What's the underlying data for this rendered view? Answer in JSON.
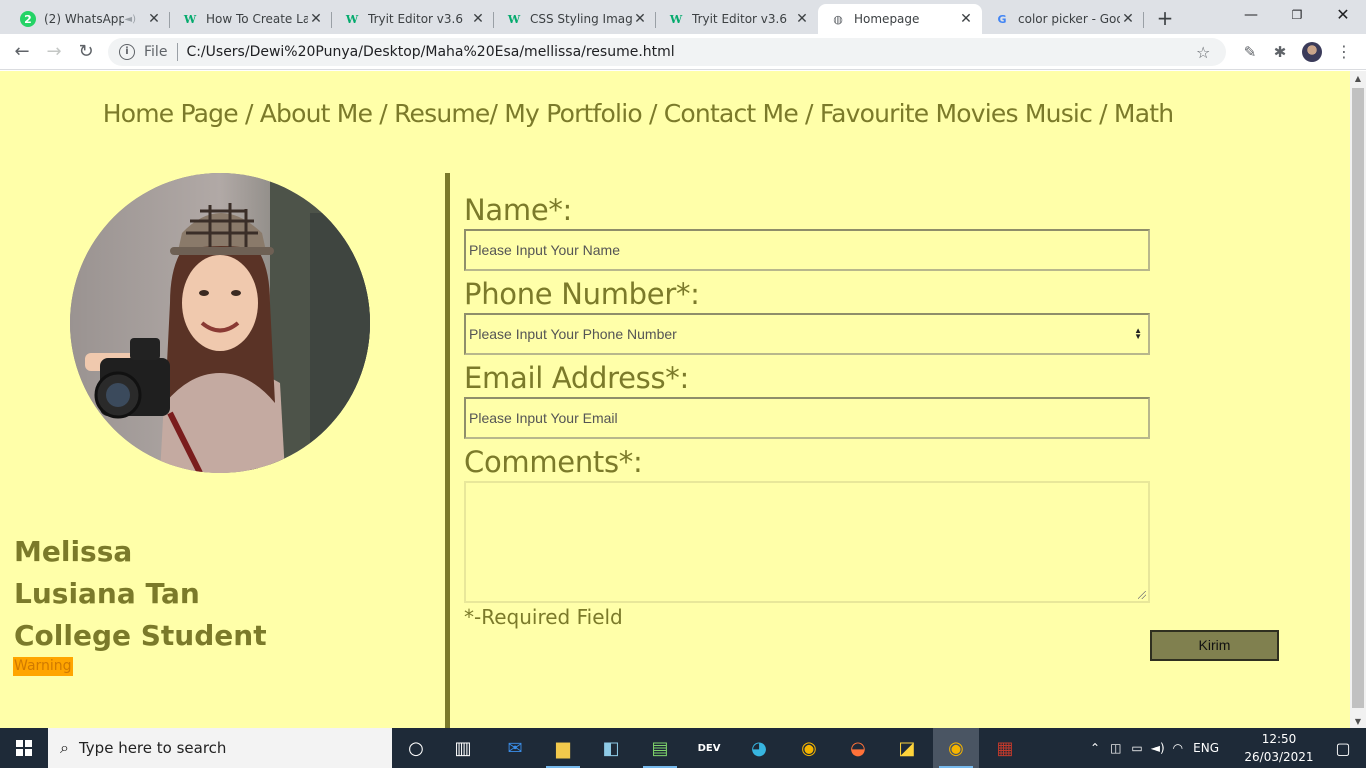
{
  "browser": {
    "tabs": [
      {
        "title": "(2) WhatsApp",
        "favicon": "whatsapp-icon",
        "badge": "2"
      },
      {
        "title": "How To Create Lab",
        "favicon": "w3schools-icon"
      },
      {
        "title": "Tryit Editor v3.6",
        "favicon": "w3schools-icon"
      },
      {
        "title": "CSS Styling Images",
        "favicon": "w3schools-icon"
      },
      {
        "title": "Tryit Editor v3.6",
        "favicon": "w3schools-icon"
      },
      {
        "title": "Homepage",
        "favicon": "globe-icon",
        "active": true
      },
      {
        "title": "color picker - Goo",
        "favicon": "google-icon"
      }
    ],
    "address": {
      "scheme_label": "File",
      "url": "C:/Users/Dewi%20Punya/Desktop/Maha%20Esa/mellissa/resume.html"
    }
  },
  "page": {
    "nav_text": "Home Page / About Me / Resume/ My Portfolio / Contact Me / Favourite Movies Music / Math",
    "profile": {
      "name_first": "Melissa",
      "name_last": "Lusiana Tan",
      "role": "College Student",
      "warning": "Warning"
    },
    "form": {
      "name_label": "Name*:",
      "name_placeholder": "Please Input Your Name",
      "phone_label": "Phone Number*:",
      "phone_placeholder": "Please Input Your Phone Number",
      "email_label": "Email Address*:",
      "email_placeholder": "Please Input Your Email",
      "comments_label": "Comments*:",
      "required_note": "*-Required Field",
      "submit_label": "Kirim"
    },
    "colors": {
      "background": "#ffffa9",
      "text": "#7b7a2a",
      "warning": "#ffa500",
      "button": "#80804f"
    }
  },
  "taskbar": {
    "search_placeholder": "Type here to search",
    "language": "ENG",
    "time": "12:50",
    "date": "26/03/2021"
  }
}
